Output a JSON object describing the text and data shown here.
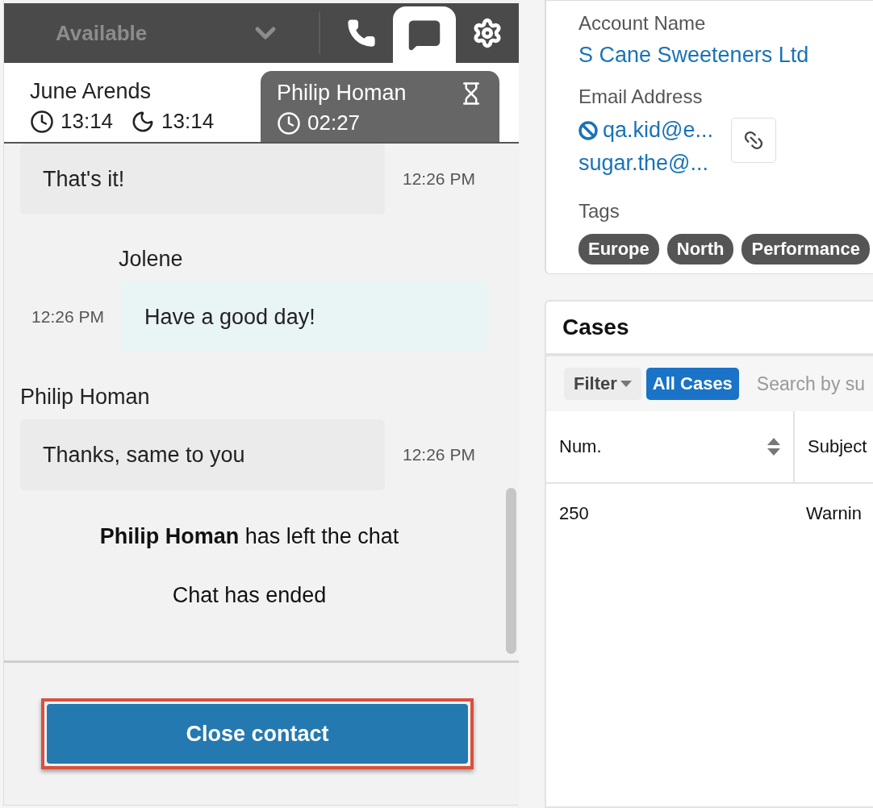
{
  "softphone": {
    "status": {
      "label": "Available"
    },
    "tabs": [
      {
        "kind": "phone",
        "selected": false
      },
      {
        "kind": "chat",
        "selected": true
      },
      {
        "kind": "settings",
        "selected": false
      }
    ],
    "contacts": [
      {
        "name": "June Arends",
        "selected": false,
        "waiting": false,
        "timers": [
          {
            "kind": "clock",
            "time": "13:14"
          },
          {
            "kind": "moon",
            "time": "13:14"
          }
        ]
      },
      {
        "name": "Philip Homan",
        "selected": true,
        "waiting": true,
        "timers": [
          {
            "kind": "clock",
            "time": "02:27"
          }
        ]
      }
    ],
    "messages": [
      {
        "kind": "incoming",
        "text": "That's it!",
        "time": "12:26 PM"
      },
      {
        "kind": "outgoing",
        "sender": "Jolene",
        "text": "Have a good day!",
        "time": "12:26 PM"
      },
      {
        "kind": "incoming",
        "sender": "Philip Homan",
        "text": "Thanks, same to you",
        "time": "12:26 PM"
      },
      {
        "kind": "event",
        "text": "**Philip Homan** has left the chat"
      },
      {
        "kind": "event",
        "text": "Chat has ended"
      }
    ],
    "close_button": {
      "label": "Close contact"
    }
  },
  "account": {
    "name_label": "Account Name",
    "name": "S Cane Sweeteners Ltd",
    "email_label": "Email Address",
    "emails": [
      {
        "address": "qa.kid@e...",
        "opted_out": true
      },
      {
        "address": "sugar.the@...",
        "opted_out": false
      }
    ],
    "tags_label": "Tags",
    "tags": [
      "Europe",
      "North",
      "Performance"
    ]
  },
  "cases": {
    "title": "Cases",
    "filter": "Filter",
    "active_filter": "All Cases",
    "search": {
      "placeholder": "Search by su"
    },
    "columns": [
      "Num.",
      "Subject"
    ],
    "rows": [
      [
        "250",
        "Warnin"
      ]
    ]
  }
}
